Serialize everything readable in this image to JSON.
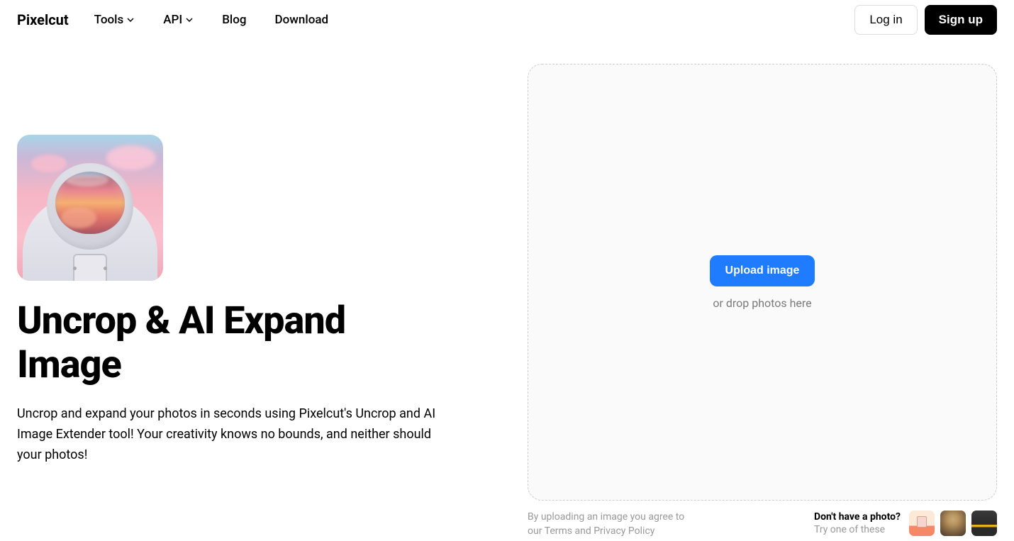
{
  "nav": {
    "logo": "Pixelcut",
    "items": {
      "tools": "Tools",
      "api": "API",
      "blog": "Blog",
      "download": "Download"
    },
    "login": "Log in",
    "signup": "Sign up"
  },
  "hero": {
    "title": "Uncrop & AI Expand Image",
    "description": "Uncrop and expand your photos in seconds using Pixelcut's Uncrop and AI Image Extender tool! Your creativity knows no bounds, and neither should your photos!"
  },
  "upload": {
    "button": "Upload image",
    "drop": "or drop photos here"
  },
  "terms": {
    "prefix": "By uploading an image you agree to our ",
    "terms": "Terms",
    "and": " and ",
    "privacy": "Privacy Policy"
  },
  "samples": {
    "question": "Don't have a photo?",
    "subtitle": "Try one of these"
  }
}
